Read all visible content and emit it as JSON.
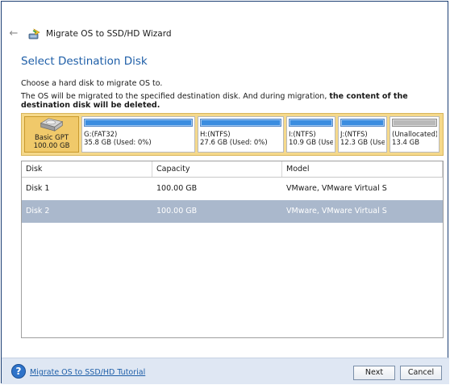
{
  "window": {
    "title": "Migrate OS to SSD/HD Wizard"
  },
  "page": {
    "title": "Select Destination Disk",
    "instruction": "Choose a hard disk to migrate OS to.",
    "warning_prefix": "The OS will be migrated to the specified destination disk. And during migration, ",
    "warning_bold": "the content of the destination disk will be deleted",
    "warning_suffix": "."
  },
  "disk_map": {
    "disk_type": "Basic GPT",
    "disk_size": "100.00 GB",
    "partitions": [
      {
        "name": "G:(FAT32)",
        "info": "35.8 GB (Used: 0%)",
        "type": "used"
      },
      {
        "name": "H:(NTFS)",
        "info": "27.6 GB (Used: 0%)",
        "type": "used"
      },
      {
        "name": "I:(NTFS)",
        "info": "10.9 GB (Used",
        "type": "used"
      },
      {
        "name": "J:(NTFS)",
        "info": "12.3 GB (Used",
        "type": "used"
      },
      {
        "name": "(Unallocated)",
        "info": "13.4 GB",
        "type": "unallocated"
      }
    ]
  },
  "table": {
    "headers": [
      "Disk",
      "Capacity",
      "Model"
    ],
    "rows": [
      {
        "disk": "Disk 1",
        "capacity": "100.00 GB",
        "model": "VMware, VMware Virtual S",
        "selected": false
      },
      {
        "disk": "Disk 2",
        "capacity": "100.00 GB",
        "model": "VMware, VMware Virtual S",
        "selected": true
      }
    ]
  },
  "footer": {
    "tutorial_link": "Migrate OS to SSD/HD Tutorial",
    "next_label": "Next",
    "cancel_label": "Cancel"
  },
  "icons": {
    "back": "arrow-left-icon",
    "app": "migrate-wizard-icon",
    "disk": "hard-disk-icon",
    "help": "help-icon"
  },
  "colors": {
    "accent": "#1f5fa8",
    "partition_bar": "#3b8de0",
    "unallocated_bar": "#b9b9b9",
    "disk_map_bg": "#f5d98b",
    "selected_row": "#aab8cc",
    "footer_bg": "#dfe7f3"
  }
}
